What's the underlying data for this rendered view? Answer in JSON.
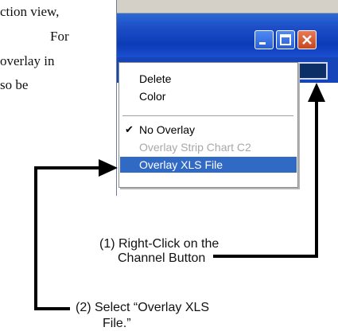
{
  "doc": {
    "lines": [
      "ction view,",
      "For",
      "overlay in",
      "so be"
    ]
  },
  "window": {
    "buttons": [
      "minimize",
      "maximize",
      "close"
    ]
  },
  "menu": {
    "items": [
      {
        "label": "Delete",
        "state": "normal"
      },
      {
        "label": "Color",
        "state": "normal"
      },
      {
        "label": "No Overlay",
        "state": "checked"
      },
      {
        "label": "Overlay Strip Chart C2",
        "state": "disabled"
      },
      {
        "label": "Overlay XLS File",
        "state": "highlighted"
      }
    ],
    "check_glyph": "✔"
  },
  "annotations": {
    "step1_line1": "(1) Right-Click on the",
    "step1_line2": "Channel Button",
    "step2_line1": "(2)  Select “Overlay XLS",
    "step2_line2": "File.”"
  },
  "colors": {
    "titlebar": "#0c3bb7",
    "menu_highlight": "#316ac5",
    "channel_button": "#0b2f66",
    "arrow": "#000000"
  }
}
